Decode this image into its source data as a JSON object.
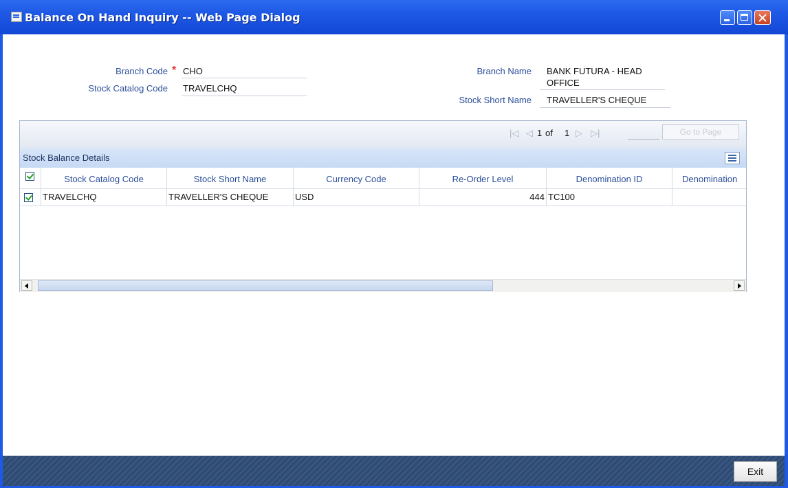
{
  "window": {
    "title": "Balance On Hand Inquiry -- Web Page Dialog"
  },
  "form": {
    "branch_code_label": "Branch Code",
    "branch_code_value": "CHO",
    "stock_catalog_code_label": "Stock Catalog Code",
    "stock_catalog_code_value": "TRAVELCHQ",
    "branch_name_label": "Branch Name",
    "branch_name_value_line1": "BANK FUTURA - HEAD",
    "branch_name_value_line2": "OFFICE",
    "stock_short_name_label": "Stock Short Name",
    "stock_short_name_value": "TRAVELLER'S CHEQUE",
    "required_marker": "*"
  },
  "pager": {
    "first_icon": "first-page-icon",
    "prev_icon": "prev-page-icon",
    "next_icon": "next-page-icon",
    "last_icon": "last-page-icon",
    "current": "1",
    "of_label": "of",
    "total": "1",
    "goto_label": "Go to Page"
  },
  "grid": {
    "section_title": "Stock Balance Details",
    "columns": [
      "Stock Catalog Code",
      "Stock Short Name",
      "Currency Code",
      "Re-Order Level",
      "Denomination ID",
      "Denomination"
    ],
    "rows": [
      {
        "stock_catalog_code": "TRAVELCHQ",
        "stock_short_name": "TRAVELLER'S CHEQUE",
        "currency_code": "USD",
        "reorder_level": "444",
        "denomination_id": "TC100",
        "denomination": ""
      }
    ]
  },
  "footer": {
    "exit_label": "Exit"
  },
  "colors": {
    "titlebar": "#1f5ae6",
    "footer": "#2e4a73",
    "label": "#2a4e9a",
    "section_bar": "#c6d9f3"
  }
}
